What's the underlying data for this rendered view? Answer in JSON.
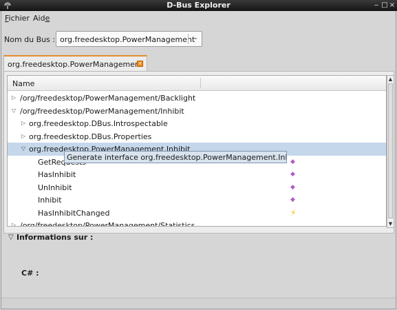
{
  "window": {
    "title": "D-Bus Explorer",
    "minimize": "‒",
    "maximize": "□",
    "close": "×"
  },
  "menu": [
    {
      "prefix": "F",
      "rest": "ichier"
    },
    {
      "prefix": "Aid",
      "mnemonic": "e",
      "suffix": ""
    }
  ],
  "bus": {
    "label": "Nom du Bus :",
    "selected": "org.freedesktop.PowerManagement",
    "arrow": "⌄"
  },
  "tab": {
    "label": "org.freedesktop.PowerManagement",
    "close": "×"
  },
  "tree": {
    "header": "Name",
    "rows": [
      {
        "level": 0,
        "expander": "▷",
        "text": "/org/freedesktop/PowerManagement/Backlight"
      },
      {
        "level": 0,
        "expander": "▽",
        "text": "/org/freedesktop/PowerManagement/Inhibit"
      },
      {
        "level": 1,
        "expander": "▷",
        "text": "org.freedesktop.DBus.Introspectable"
      },
      {
        "level": 1,
        "expander": "▷",
        "text": "org.freedesktop.DBus.Properties"
      },
      {
        "level": 1,
        "expander": "▽",
        "text": "org.freedesktop.PowerManagement.Inhibit",
        "selected": true
      },
      {
        "level": 2,
        "text": "GetRequests",
        "mark": "method"
      },
      {
        "level": 2,
        "text": "HasInhibit",
        "mark": "method"
      },
      {
        "level": 2,
        "text": "UnInhibit",
        "mark": "method"
      },
      {
        "level": 2,
        "text": "Inhibit",
        "mark": "method"
      },
      {
        "level": 2,
        "text": "HasInhibitChanged",
        "mark": "signal"
      },
      {
        "level": 0,
        "expander": "▷",
        "text": "/org/freedesktop/PowerManagement/Statistics"
      }
    ],
    "tooltip": "Generate interface org.freedesktop.PowerManagement.Inhibit ...",
    "method_glyph": "◆",
    "signal_glyph": "⚡"
  },
  "info": {
    "toggle": "▽",
    "title": "Informations sur :",
    "cs_label": "C# :"
  },
  "colors": {
    "accent_tab": "#e48b2e",
    "selection": "#c5d7ea",
    "method": "#b05ac8",
    "signal": "#f0c000"
  }
}
